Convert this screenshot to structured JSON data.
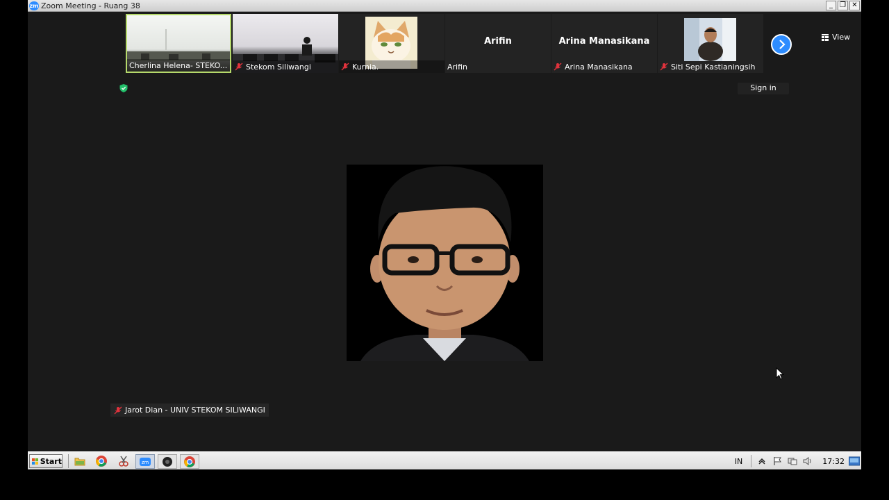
{
  "window": {
    "title": "Zoom Meeting - Ruang 38",
    "app_icon_text": "zm"
  },
  "participants": [
    {
      "name": "Cherlina Helena- STEKO...",
      "muted": false,
      "active": true,
      "type": "video-room"
    },
    {
      "name": "Stekom Siliwangi",
      "muted": true,
      "active": false,
      "type": "video-room"
    },
    {
      "name": "Kurnia.",
      "muted": true,
      "active": false,
      "type": "avatar-cat"
    },
    {
      "name": "Arifin",
      "display_name": "Arifin",
      "muted": false,
      "active": false,
      "type": "name-only"
    },
    {
      "name": "Arina Manasikana",
      "display_name": "Arina Manasikana",
      "muted": true,
      "active": false,
      "type": "name-only"
    },
    {
      "name": "Siti Sepi Kastianingsih",
      "muted": true,
      "active": false,
      "type": "video-person"
    }
  ],
  "toolbar": {
    "view_label": "View",
    "sign_in_label": "Sign in"
  },
  "active_speaker": {
    "name": "Jarot Dian - UNIV STEKOM SILIWANGI",
    "muted": true
  },
  "taskbar": {
    "start_label": "Start",
    "language": "IN",
    "clock": "17:32"
  },
  "colors": {
    "zoom_blue": "#2d8cff",
    "mic_off_red": "#e0323c",
    "active_border": "#b5d96b",
    "background": "#1a1a1a"
  }
}
